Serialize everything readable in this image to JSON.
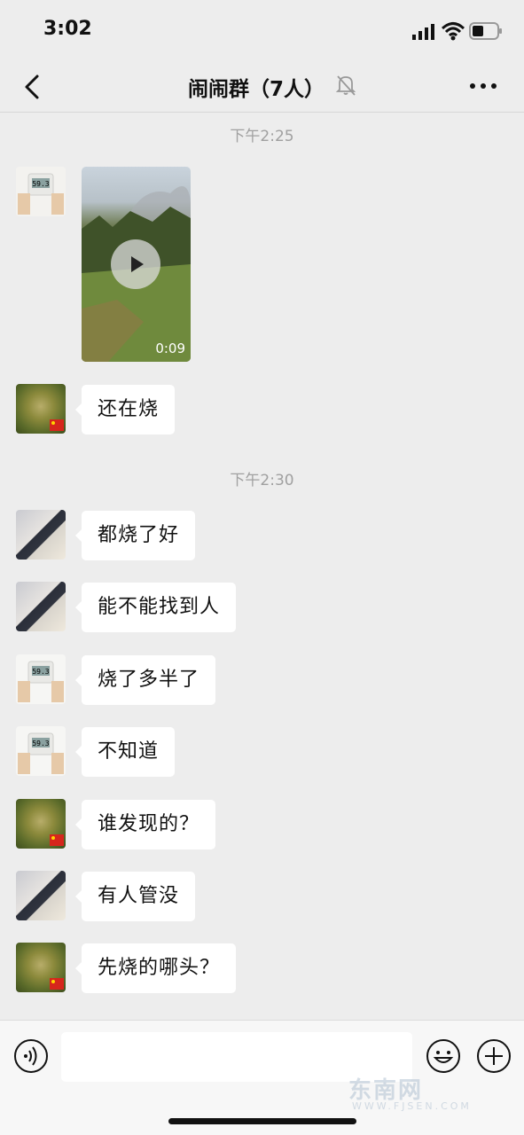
{
  "status_bar": {
    "time": "3:02"
  },
  "nav": {
    "title": "闹闹群（7人）"
  },
  "chat": {
    "timestamps": [
      "下午2:25",
      "下午2:30"
    ],
    "video": {
      "duration": "0:09"
    },
    "messages": [
      {
        "text": "还在烧"
      },
      {
        "text": "都烧了好"
      },
      {
        "text": "能不能找到人"
      },
      {
        "text": "烧了多半了"
      },
      {
        "text": "不知道"
      },
      {
        "text": "谁发现的？"
      },
      {
        "text": "有人管没"
      },
      {
        "text": "先烧的哪头？"
      }
    ],
    "scale_reading": "59.3"
  },
  "watermark": {
    "main": "东南网",
    "sub": "WWW.FJSEN.COM"
  },
  "colors": {
    "background": "#ededed",
    "bubble": "#ffffff",
    "timestamp": "#a0a0a0"
  },
  "icons": [
    "back-chevron-icon",
    "mute-bell-icon",
    "more-icon",
    "voice-icon",
    "emoji-icon",
    "plus-icon",
    "play-icon",
    "signal-icon",
    "wifi-icon",
    "battery-icon"
  ]
}
